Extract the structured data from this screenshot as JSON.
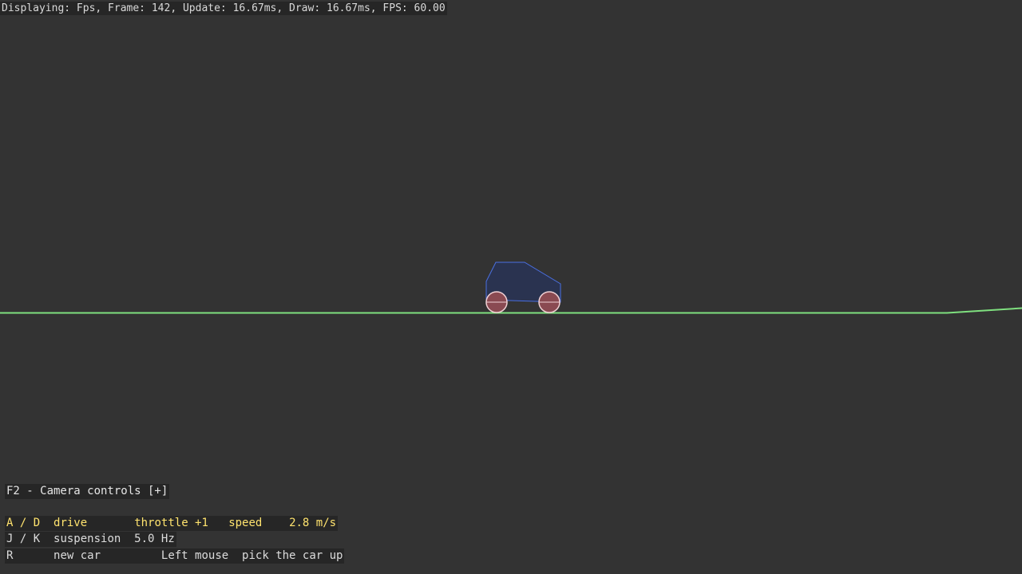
{
  "stats": {
    "text": "Displaying: Fps, Frame: 142, Update: 16.67ms, Draw: 16.67ms, FPS: 60.00"
  },
  "camera_hint": {
    "text": "F2 - Camera controls [+]"
  },
  "controls": {
    "drive": {
      "key": "A / D",
      "action": "drive",
      "throttle": "throttle +1",
      "speed_label": "speed",
      "speed_value": "2.8 m/s"
    },
    "suspension": {
      "key": "J / K",
      "action": "suspension",
      "value": "5.0 Hz"
    },
    "reset": {
      "key": "R",
      "action": "new car",
      "mouse_key": "Left mouse",
      "mouse_action": "pick the car up"
    }
  },
  "colors": {
    "background": "#333333",
    "ground": "#7fe07f",
    "car_body_fill": "#2a3350",
    "car_body_stroke": "#4a6fe0",
    "wheel_fill": "#8a4a52",
    "wheel_stroke": "#f0d0d4",
    "highlight_row": "#ffe36e"
  }
}
